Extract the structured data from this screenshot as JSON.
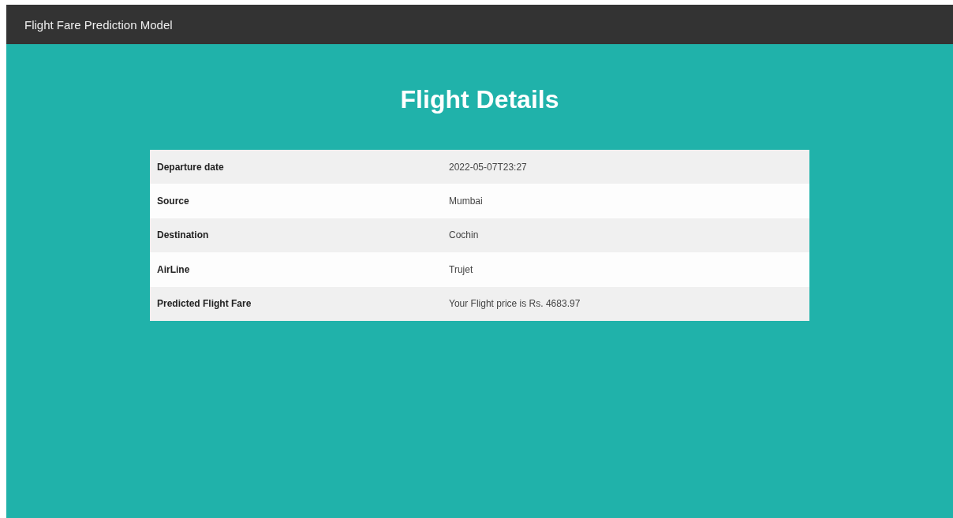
{
  "navbar": {
    "brand": "Flight Fare Prediction Model"
  },
  "heading": "Flight Details",
  "table": {
    "rows": [
      {
        "label": "Departure date",
        "value": "2022-05-07T23:27"
      },
      {
        "label": "Source",
        "value": "Mumbai"
      },
      {
        "label": "Destination",
        "value": "Cochin"
      },
      {
        "label": "AirLine",
        "value": "Trujet"
      },
      {
        "label": "Predicted Flight Fare",
        "value": "Your Flight price is Rs. 4683.97"
      }
    ]
  }
}
